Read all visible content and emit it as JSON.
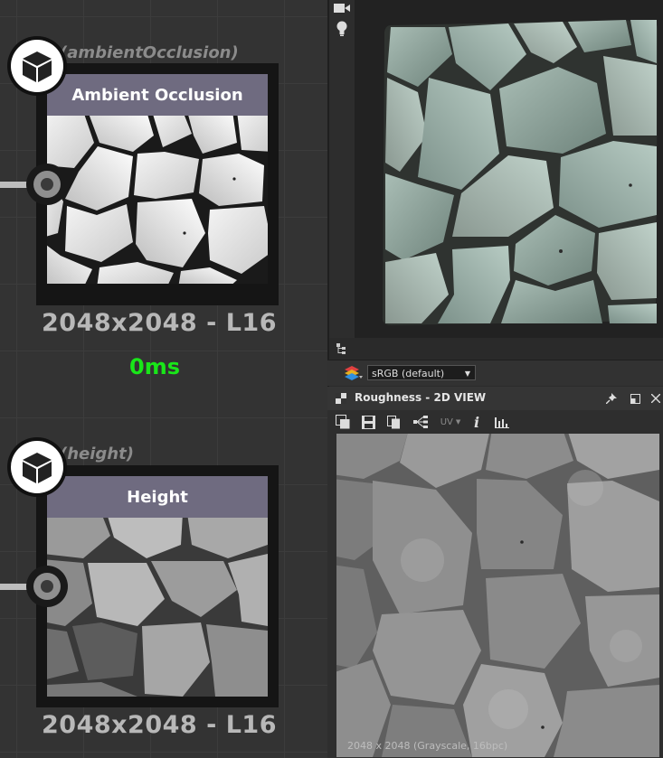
{
  "graph": {
    "nodes": [
      {
        "tag": "(ambientOcclusion)",
        "title": "Ambient Occlusion",
        "size_label": "2048x2048 - L16",
        "time_label": "0ms",
        "icon": "cube-icon"
      },
      {
        "tag": "(height)",
        "title": "Height",
        "size_label": "2048x2048 - L16",
        "icon": "cube-icon"
      }
    ]
  },
  "view3d": {
    "toolbar_icons": [
      "camera-icon",
      "light-bulb-icon"
    ],
    "bottom_icon": "scene-tree-icon"
  },
  "colorspace": {
    "icon": "layers-icon",
    "selected": "sRGB (default)"
  },
  "panel2d": {
    "title": "Roughness - 2D VIEW",
    "tools": {
      "uv_label": "UV",
      "info_label": "i"
    },
    "status": "2048 x 2048 (Grayscale, 16bpc)",
    "colors": {
      "header_bg": "#353535",
      "accent": "#6f6b80",
      "time_green": "#19e619"
    }
  }
}
